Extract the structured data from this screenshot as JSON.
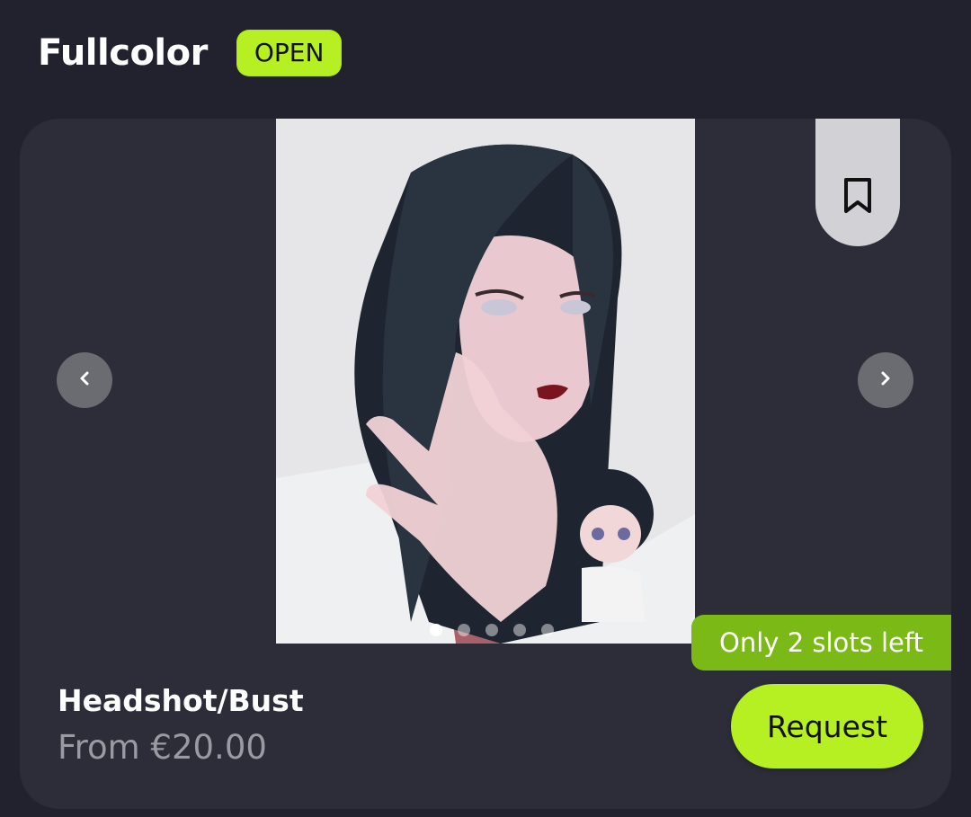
{
  "section": {
    "title": "Fullcolor",
    "status": "OPEN"
  },
  "card": {
    "slots_left": "Only 2 slots left",
    "product_name": "Headshot/Bust",
    "price": "From €20.00",
    "request_label": "Request",
    "carousel": {
      "total_images": 5,
      "active_index": 0
    }
  },
  "colors": {
    "background": "#22222e",
    "card": "#2d2d3a",
    "accent": "#b6ef22",
    "slots_badge": "#7bba16"
  },
  "icons": {
    "prev": "chevron-left-icon",
    "next": "chevron-right-icon",
    "bookmark": "bookmark-icon"
  }
}
